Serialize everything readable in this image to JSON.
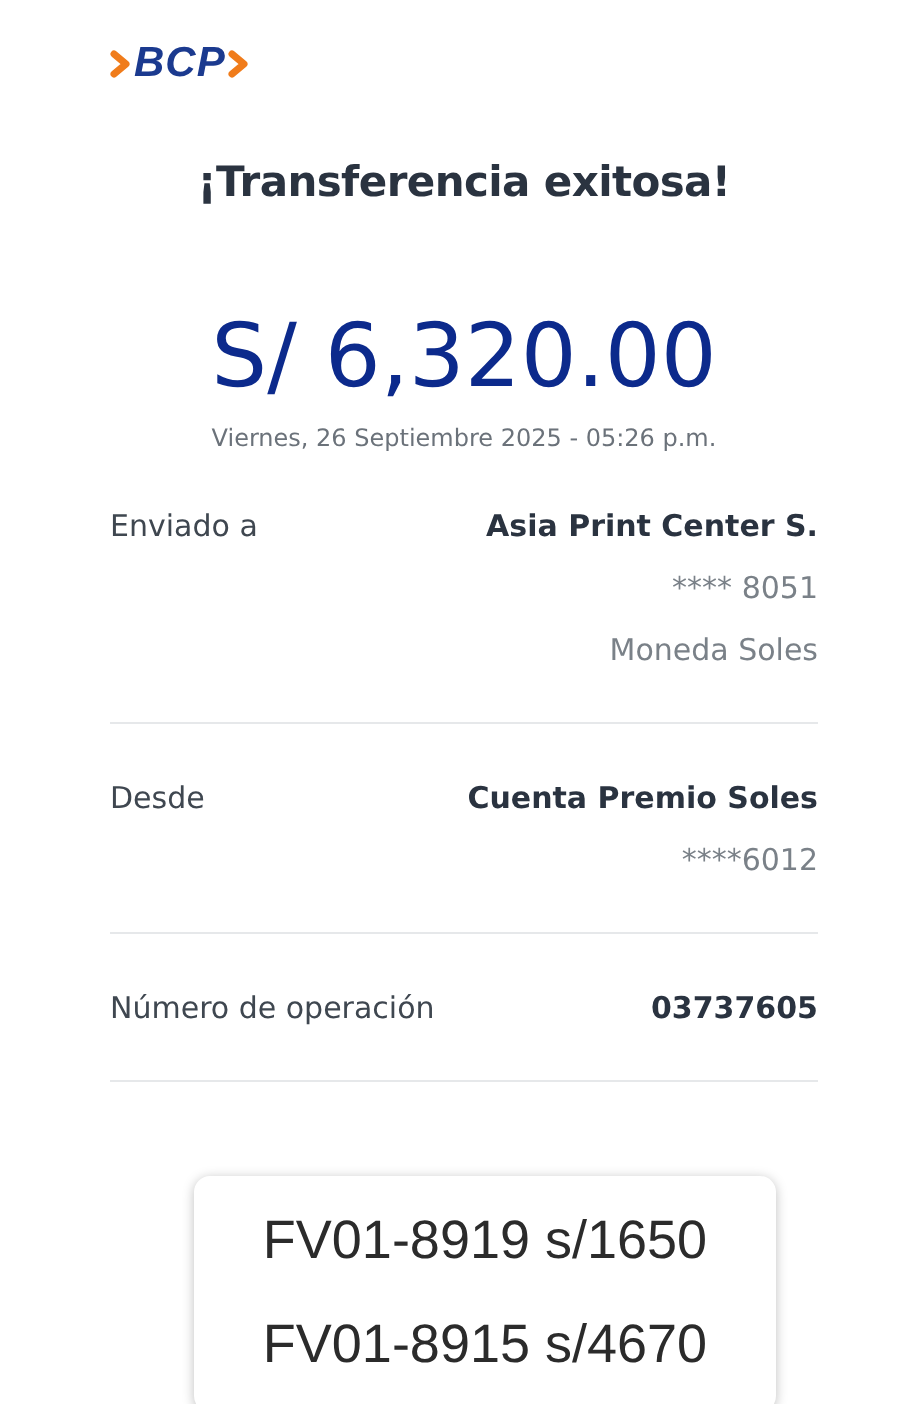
{
  "logo": {
    "text": "BCP"
  },
  "title": "¡Transferencia exitosa!",
  "amount": "S/ 6,320.00",
  "date": "Viernes, 26 Septiembre 2025 - 05:26 p.m.",
  "details": [
    {
      "label": "Enviado a",
      "values": [
        "Asia Print Center S.",
        "**** 8051",
        "Moneda Soles"
      ]
    },
    {
      "label": "Desde",
      "values": [
        "Cuenta Premio Soles",
        "****6012"
      ]
    },
    {
      "label": "Número de operación",
      "values": [
        "03737605"
      ]
    }
  ],
  "note": {
    "lines": [
      "FV01-8919 s/1650",
      "FV01-8915 s/4670"
    ]
  }
}
